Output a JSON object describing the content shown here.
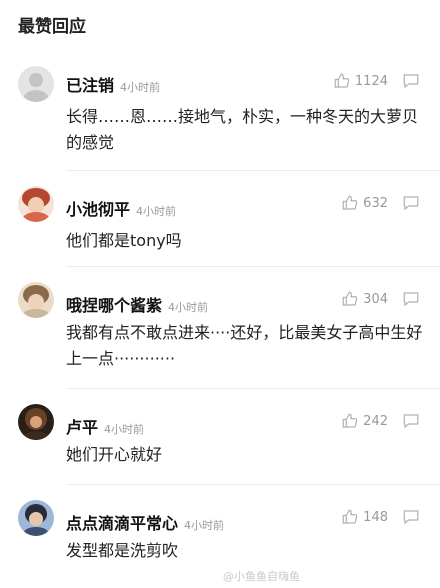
{
  "section_title": "最赞回应",
  "comments": [
    {
      "username": "已注销",
      "time": "4小时前",
      "likes": "1124",
      "text": "长得……恩……接地气，朴实，一种冬天的大萝贝的感觉"
    },
    {
      "username": "小池彻平",
      "time": "4小时前",
      "likes": "632",
      "text": "他们都是tony吗"
    },
    {
      "username": "哦捏哪个酱紫",
      "time": "4小时前",
      "likes": "304",
      "text": "我都有点不敢点进来····还好，比最美女子高中生好上一点············"
    },
    {
      "username": "卢平",
      "time": "4小时前",
      "likes": "242",
      "text": "她们开心就好"
    },
    {
      "username": "点点滴滴平常心",
      "time": "4小时前",
      "likes": "148",
      "text": "发型都是洗剪吹"
    }
  ],
  "watermark": "@小鱼鱼自嗨鱼",
  "icons": {
    "like": "thumbs-up-icon",
    "reply": "comment-bubble-icon"
  },
  "colors": {
    "meta_text": "#9a9a9a",
    "divider": "#ececec"
  }
}
